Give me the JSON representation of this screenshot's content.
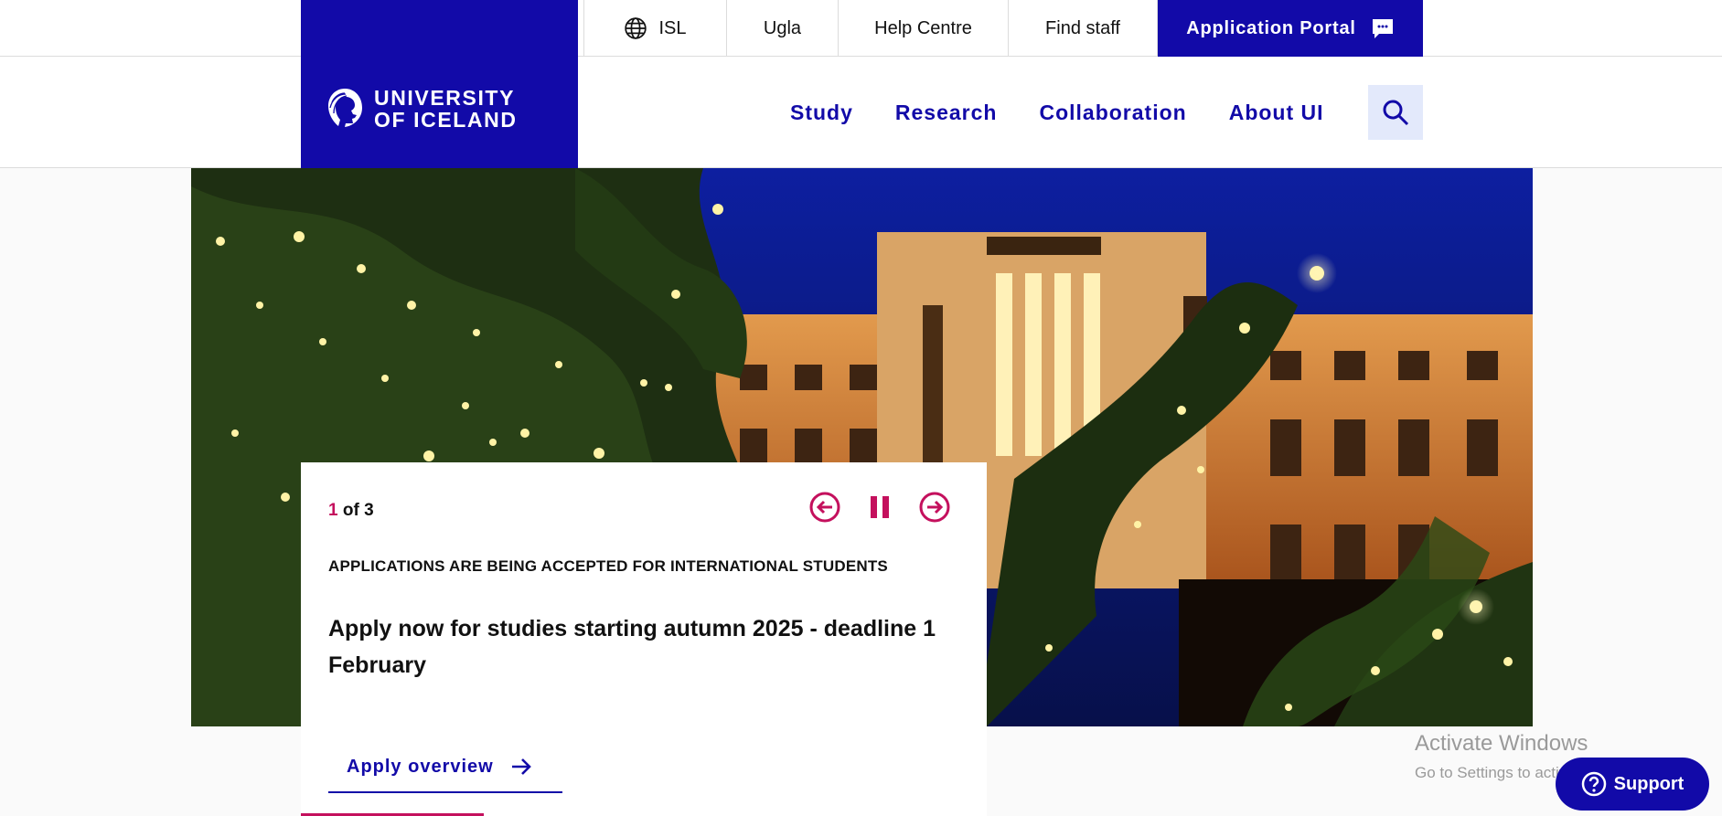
{
  "utility_nav": {
    "language": "ISL",
    "ugla": "Ugla",
    "help_centre": "Help Centre",
    "find_staff": "Find staff",
    "application_portal": "Application Portal"
  },
  "logo": {
    "line1": "UNIVERSITY",
    "line2": "OF ICELAND"
  },
  "main_nav": {
    "study": "Study",
    "research": "Research",
    "collaboration": "Collaboration",
    "about": "About UI"
  },
  "slider": {
    "current": "1",
    "of_total": " of 3",
    "kicker": "APPLICATIONS ARE BEING ACCEPTED FOR INTERNATIONAL STUDENTS",
    "headline": "Apply now for studies starting autumn 2025 - deadline 1 February",
    "link_label": "Apply overview"
  },
  "watermark": {
    "title": "Activate Windows",
    "subtitle": "Go to Settings to activate Windows."
  },
  "support": {
    "label": "Support"
  },
  "colors": {
    "brand": "#120aa8",
    "accent": "#c4105d",
    "search_bg": "#e3e9fb"
  }
}
